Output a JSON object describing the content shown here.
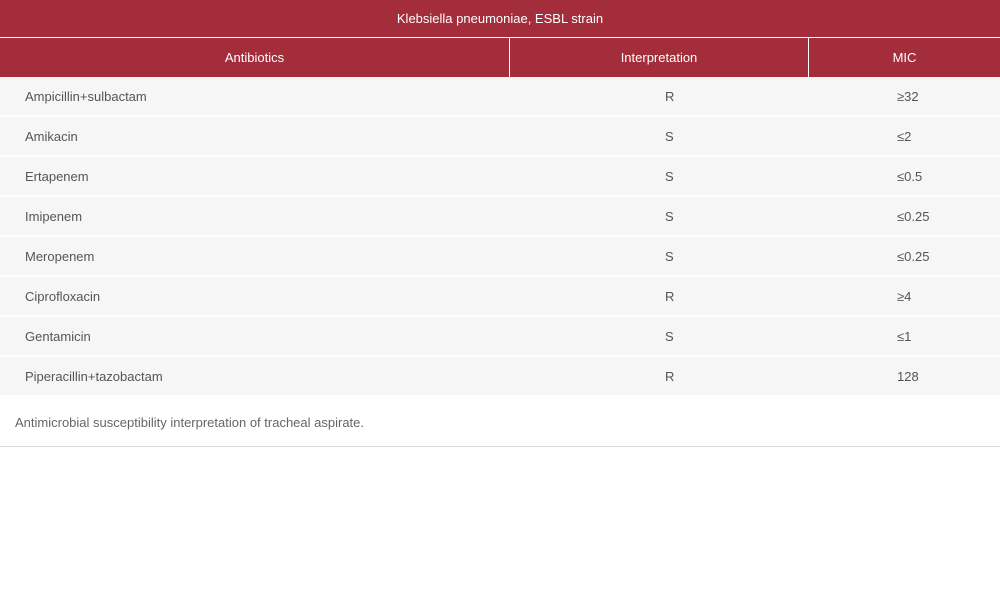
{
  "colors": {
    "accent": "#a32d3a",
    "row_background": "#f6f6f6",
    "text": "#555555"
  },
  "table": {
    "title": "Klebsiella pneumoniae, ESBL strain",
    "headers": {
      "antibiotics": "Antibiotics",
      "interpretation": "Interpretation",
      "mic": "MIC"
    },
    "rows": [
      {
        "antibiotic": "Ampicillin+sulbactam",
        "interpretation": "R",
        "mic": "≥32"
      },
      {
        "antibiotic": "Amikacin",
        "interpretation": "S",
        "mic": "≤2"
      },
      {
        "antibiotic": "Ertapenem",
        "interpretation": "S",
        "mic": "≤0.5"
      },
      {
        "antibiotic": "Imipenem",
        "interpretation": "S",
        "mic": "≤0.25"
      },
      {
        "antibiotic": "Meropenem",
        "interpretation": "S",
        "mic": "≤0.25"
      },
      {
        "antibiotic": "Ciprofloxacin",
        "interpretation": "R",
        "mic": "≥4"
      },
      {
        "antibiotic": "Gentamicin",
        "interpretation": "S",
        "mic": "≤1"
      },
      {
        "antibiotic": "Piperacillin+tazobactam",
        "interpretation": "R",
        "mic": "128"
      }
    ],
    "caption": "Antimicrobial susceptibility interpretation of tracheal aspirate."
  }
}
